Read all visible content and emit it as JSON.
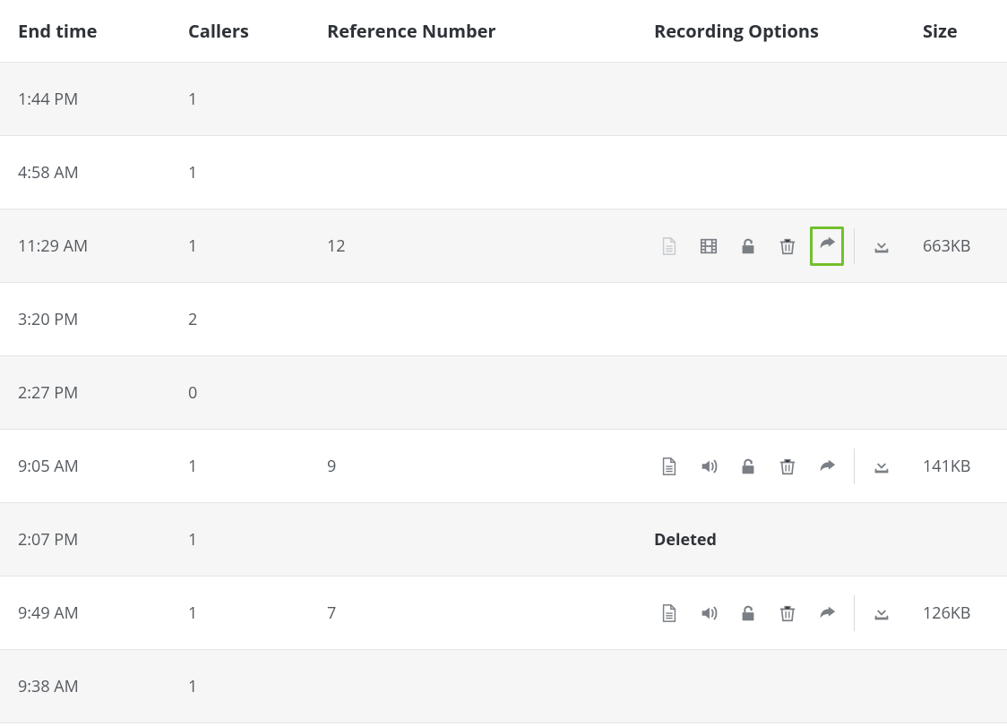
{
  "headers": {
    "end_time": "End time",
    "callers": "Callers",
    "reference": "Reference Number",
    "options": "Recording Options",
    "size": "Size"
  },
  "status_deleted": "Deleted",
  "rows": [
    {
      "end_time": "1:44 PM",
      "callers": "1",
      "reference": "",
      "options_type": "none",
      "size": ""
    },
    {
      "end_time": "4:58 AM",
      "callers": "1",
      "reference": "",
      "options_type": "none",
      "size": ""
    },
    {
      "end_time": "11:29 AM",
      "callers": "1",
      "reference": "12",
      "options_type": "video",
      "size": "663KB",
      "highlight_share": true
    },
    {
      "end_time": "3:20 PM",
      "callers": "2",
      "reference": "",
      "options_type": "none",
      "size": ""
    },
    {
      "end_time": "2:27 PM",
      "callers": "0",
      "reference": "",
      "options_type": "none",
      "size": ""
    },
    {
      "end_time": "9:05 AM",
      "callers": "1",
      "reference": "9",
      "options_type": "audio",
      "size": "141KB"
    },
    {
      "end_time": "2:07 PM",
      "callers": "1",
      "reference": "",
      "options_type": "deleted",
      "size": ""
    },
    {
      "end_time": "9:49 AM",
      "callers": "1",
      "reference": "7",
      "options_type": "audio",
      "size": "126KB"
    },
    {
      "end_time": "9:38 AM",
      "callers": "1",
      "reference": "",
      "options_type": "none",
      "size": ""
    }
  ]
}
